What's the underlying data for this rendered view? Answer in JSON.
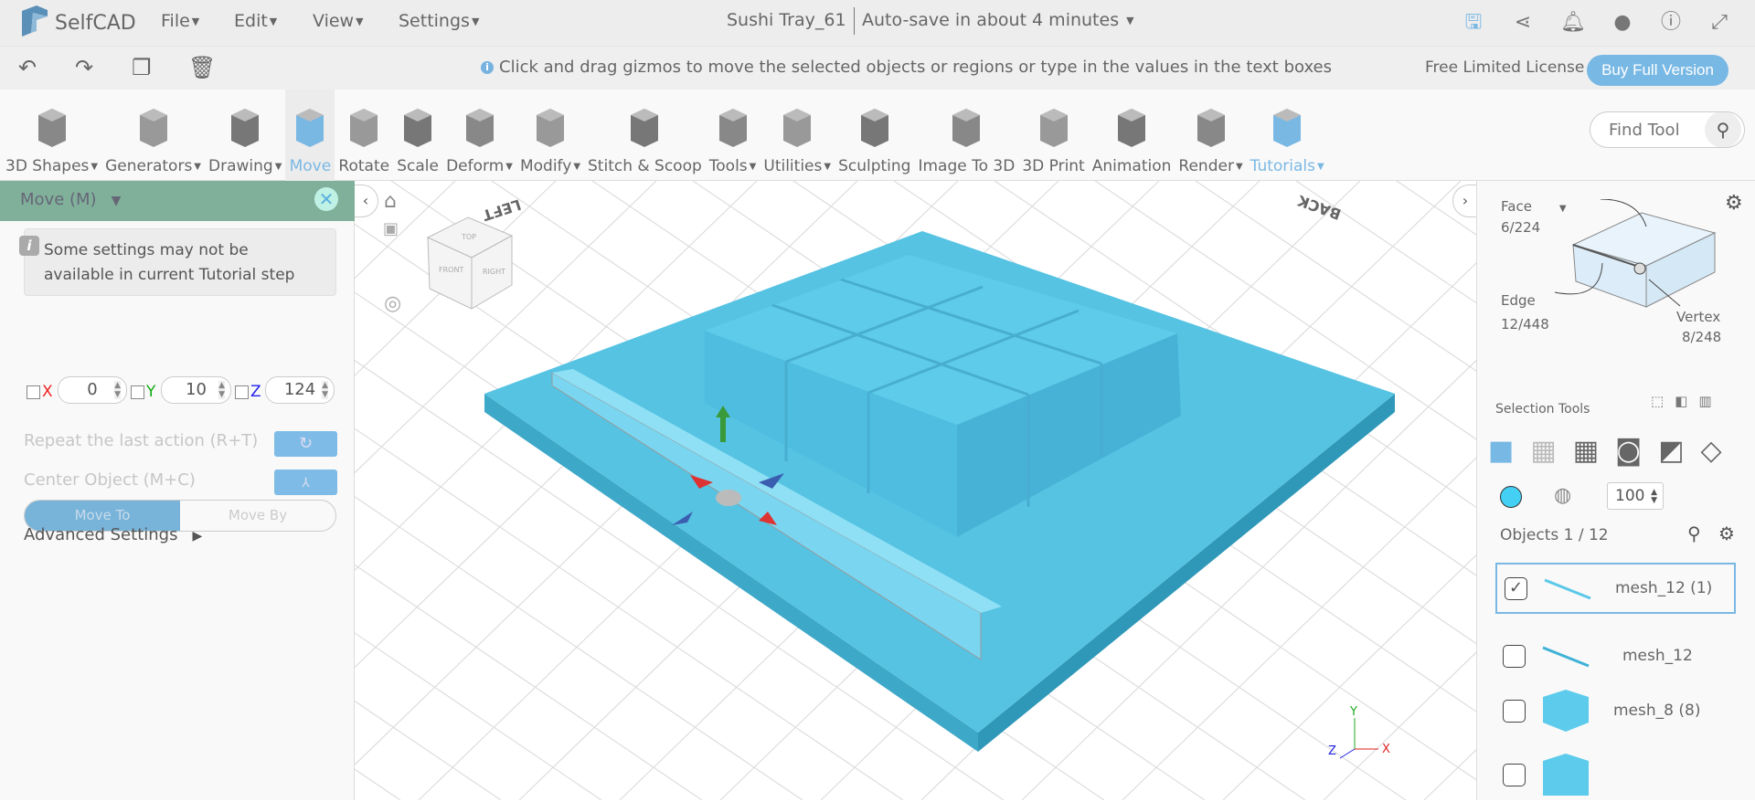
{
  "app": {
    "name": "SelfCAD",
    "menus": [
      "File",
      "Edit",
      "View",
      "Settings"
    ],
    "doc_title": "Sushi Tray_61",
    "autosave": "Auto-save in about 4 minutes"
  },
  "top_icons": [
    "save-icon",
    "share-icon",
    "bell-icon",
    "user-icon",
    "info-icon",
    "fullscreen-icon"
  ],
  "bar2": {
    "hint": "Click and drag gizmos to move the selected objects or regions or type in the values in the text boxes",
    "license": "Free Limited License",
    "buy": "Buy Full Version"
  },
  "ribbon": [
    {
      "label": "3D Shapes",
      "dd": true
    },
    {
      "label": "Generators",
      "dd": true
    },
    {
      "label": "Drawing",
      "dd": true
    },
    {
      "label": "Move",
      "dd": false,
      "active": true
    },
    {
      "label": "Rotate",
      "dd": false
    },
    {
      "label": "Scale",
      "dd": false
    },
    {
      "label": "Deform",
      "dd": true
    },
    {
      "label": "Modify",
      "dd": true
    },
    {
      "label": "Stitch & Scoop",
      "dd": false
    },
    {
      "label": "Tools",
      "dd": true
    },
    {
      "label": "Utilities",
      "dd": true
    },
    {
      "label": "Sculpting",
      "dd": false
    },
    {
      "label": "Image To 3D",
      "dd": false
    },
    {
      "label": "3D Print",
      "dd": false
    },
    {
      "label": "Animation",
      "dd": false
    },
    {
      "label": "Render",
      "dd": true
    },
    {
      "label": "Tutorials",
      "dd": true,
      "tut": true
    }
  ],
  "find_tool": {
    "placeholder": "Find Tool"
  },
  "left_panel": {
    "title": "Move (M)",
    "note": "Some settings may not be available in current Tutorial step",
    "move_to": "Move To",
    "move_by": "Move By",
    "x_label": "X",
    "y_label": "Y",
    "z_label": "Z",
    "x": "0",
    "y": "10",
    "z": "124",
    "repeat": "Repeat the last action (R+T)",
    "center": "Center Object (M+C)",
    "advanced": "Advanced Settings"
  },
  "viewport": {
    "cube_top": "TOP",
    "cube_front": "FRONT",
    "cube_right": "RIGHT",
    "label_left": "LEFT",
    "label_back": "BACK",
    "axis_x": "X",
    "axis_y": "Y",
    "axis_z": "Z"
  },
  "right_panel": {
    "face": "Face",
    "face_count": "6/224",
    "edge": "Edge",
    "edge_count": "12/448",
    "vertex": "Vertex",
    "vertex_count": "8/248",
    "selection_tools": "Selection Tools",
    "opacity": "100",
    "objects": "Objects 1 / 12",
    "color": "#44d0f5",
    "items": [
      {
        "name": "mesh_12 (1)",
        "checked": true
      },
      {
        "name": "mesh_12",
        "checked": false
      },
      {
        "name": "mesh_8 (8)",
        "checked": false
      }
    ]
  },
  "colors": {
    "accent": "#78b8e4",
    "panel_header": "#80b09a",
    "model": "#56c3e3"
  }
}
